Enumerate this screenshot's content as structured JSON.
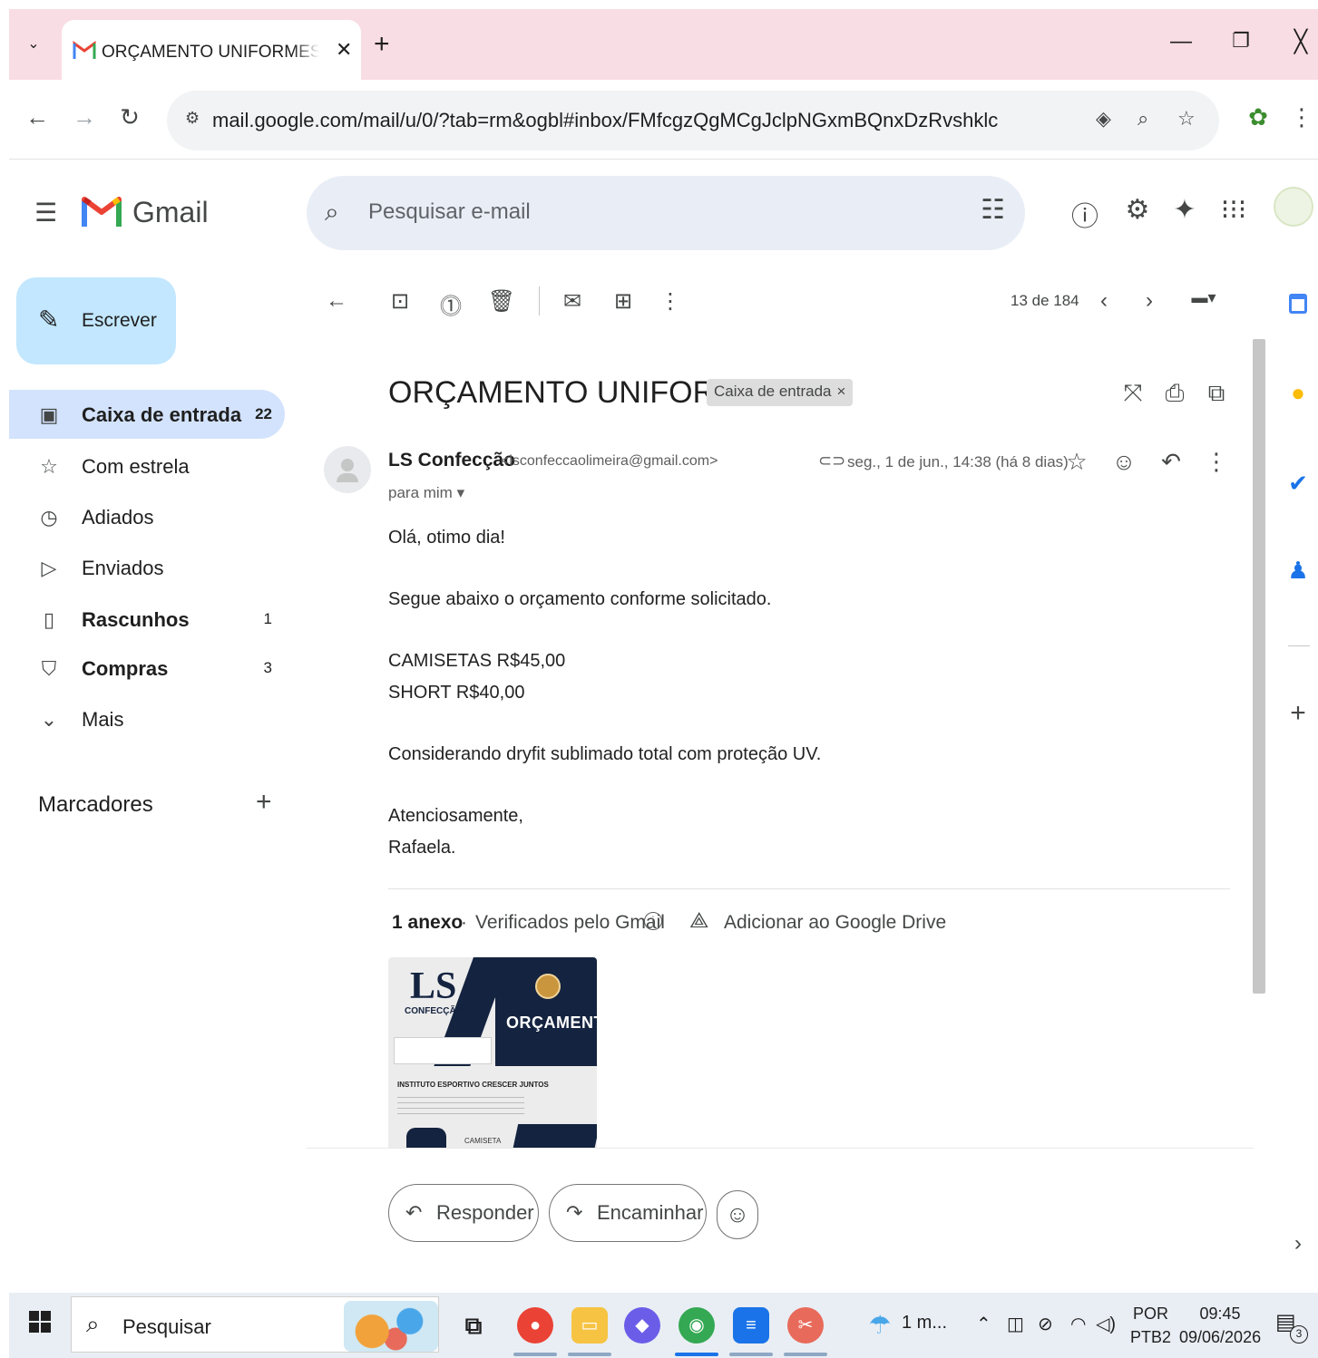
{
  "browser": {
    "tab_title": "ORÇAMENTO UNIFORMES - acesso",
    "tab_close": "✕",
    "new_tab": "+",
    "url": "mail.google.com/mail/u/0/?tab=rm&ogbl#inbox/FMfcgzQgMCgJclpNGxmBQnxDzRvshklc"
  },
  "gmail": {
    "wordmark": "Gmail",
    "search_placeholder": "Pesquisar e-mail",
    "compose_label": "Escrever",
    "nav": [
      {
        "label": "Caixa de entrada",
        "count": "22",
        "icon": "inbox-icon"
      },
      {
        "label": "Com estrela",
        "count": "",
        "icon": "star-icon"
      },
      {
        "label": "Adiados",
        "count": "",
        "icon": "clock-icon"
      },
      {
        "label": "Enviados",
        "count": "",
        "icon": "send-icon"
      },
      {
        "label": "Rascunhos",
        "count": "1",
        "icon": "draft-icon"
      },
      {
        "label": "Compras",
        "count": "3",
        "icon": "shopping-bag-icon"
      },
      {
        "label": "Mais",
        "count": "",
        "icon": "chevron-down-icon"
      }
    ],
    "labels_heading": "Marcadores"
  },
  "message": {
    "pager": "13 de 184",
    "subject": "ORÇAMENTO UNIFORMES",
    "label_chip": "Caixa de entrada",
    "sender_name": "LS Confecção",
    "sender_email": "<lsconfeccaolimeira@gmail.com>",
    "to": "para mim",
    "date": "seg., 1 de jun., 14:38 (há 8 dias)",
    "body": [
      "Olá, otimo dia!",
      "Segue abaixo o orçamento conforme solicitado.",
      "CAMISETAS R$45,00",
      "SHORT R$40,00",
      "Considerando dryfit sublimado total com proteção UV.",
      "Atenciosamente,",
      "Rafaela."
    ],
    "attachments": {
      "count_label": "1 anexo",
      "verified": "Verificados pelo Gmail",
      "add_drive": "Adicionar ao Google Drive",
      "thumb": {
        "brand": "LS",
        "brand_sub": "CONFECÇÃO",
        "title": "ORÇAMENTO",
        "institution": "INSTITUTO ESPORTIVO CRESCER JUNTOS",
        "item": "CAMISETA"
      }
    },
    "reply_label": "Responder",
    "forward_label": "Encaminhar"
  },
  "taskbar": {
    "search_placeholder": "Pesquisar",
    "weather": "1 m...",
    "lang_top": "POR",
    "lang_bottom": "PTB2",
    "time": "09:45",
    "date": "09/06/2026",
    "notifications": "3"
  },
  "colors": {
    "tabstrip": "#f9dde4",
    "compose": "#c2e7ff",
    "active_nav": "#d3e3fd",
    "search_bg": "#e9eef6"
  }
}
